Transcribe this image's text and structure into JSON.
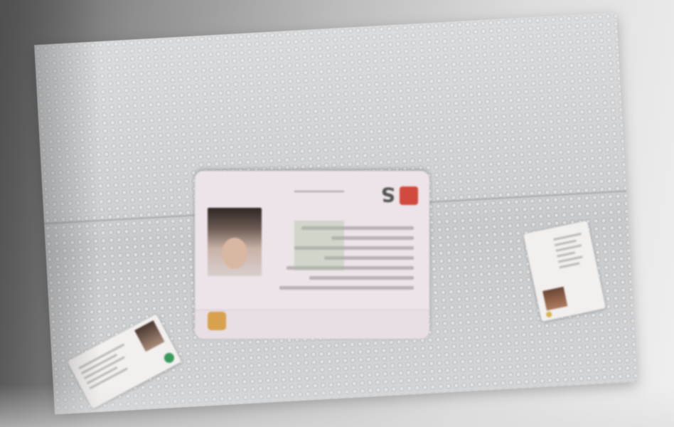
{
  "scene": {
    "description_labels": {
      "background": "gray-gradient-backdrop",
      "surface": "bubble-wrap-sheet"
    },
    "cards": {
      "main": {
        "orientation": "upside-down",
        "accent_colors": [
          "#d24a3d",
          "#d8a14d"
        ]
      },
      "small_left": {
        "accent_color": "#3a9a5c"
      },
      "small_right": {
        "accent_color": "#d8b24a"
      }
    }
  }
}
